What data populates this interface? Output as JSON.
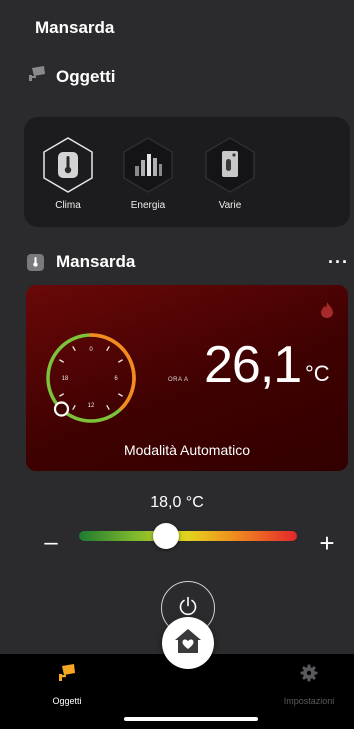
{
  "app": {
    "title": "Mansarda"
  },
  "section": {
    "label": "Oggetti",
    "icon": "cctv-icon"
  },
  "categories": [
    {
      "label": "Clima",
      "icon": "thermometer-icon",
      "selected": true
    },
    {
      "label": "Energia",
      "icon": "bar-chart-icon",
      "selected": false
    },
    {
      "label": "Varie",
      "icon": "switch-icon",
      "selected": false
    }
  ],
  "device": {
    "name": "Mansarda",
    "icon": "thermometer-icon",
    "more_label": "···"
  },
  "thermostat": {
    "ora_label": "ORA A",
    "current_temp": "26,1",
    "unit": "°C",
    "mode_label": "Modalità Automatico",
    "dial_labels": [
      "0",
      "6",
      "12",
      "18"
    ],
    "accent_color": "#f58a1f",
    "background_color": "#4a0303"
  },
  "setpoint": {
    "value_label": "18,0 °C",
    "minus_label": "–",
    "plus_label": "+",
    "slider_fraction": 0.4
  },
  "controls": {
    "power_icon": "power-icon",
    "home_icon": "home-heart-icon"
  },
  "tabs": [
    {
      "label": "Oggetti",
      "icon": "cctv-icon",
      "active": true
    },
    {
      "label": "Impostazioni",
      "icon": "gear-icon",
      "active": false
    }
  ],
  "colors": {
    "active_tab": "#f5a623",
    "inactive_tab": "#5a5a5e"
  }
}
